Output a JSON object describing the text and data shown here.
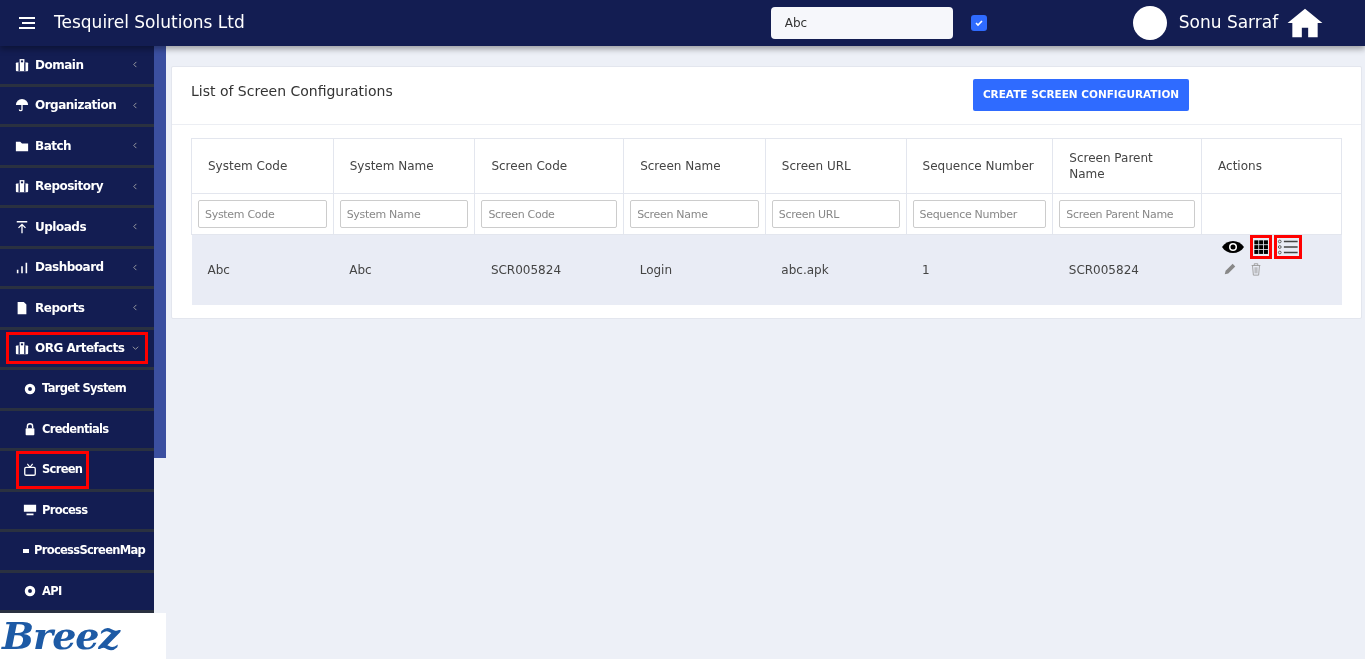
{
  "header": {
    "title": "Tesquirel Solutions Ltd",
    "search": {
      "value": "Abc"
    },
    "checkbox": {
      "checked": true
    },
    "user": "Sonu Sarraf"
  },
  "sidebar": {
    "items": [
      {
        "label": "Domain",
        "expanded": false,
        "highlighted": false
      },
      {
        "label": "Organization",
        "expanded": false,
        "highlighted": false
      },
      {
        "label": "Batch",
        "expanded": false,
        "highlighted": false
      },
      {
        "label": "Repository",
        "expanded": false,
        "highlighted": false
      },
      {
        "label": "Uploads",
        "expanded": false,
        "highlighted": false
      },
      {
        "label": "Dashboard",
        "expanded": false,
        "highlighted": false
      },
      {
        "label": "Reports",
        "expanded": false,
        "highlighted": false
      },
      {
        "label": "ORG Artefacts",
        "expanded": true,
        "highlighted": true,
        "children": [
          {
            "label": "Target System",
            "highlighted": false
          },
          {
            "label": "Credentials",
            "highlighted": false
          },
          {
            "label": "Screen",
            "highlighted": true
          },
          {
            "label": "Process",
            "highlighted": false
          },
          {
            "label": "ProcessScreenMap",
            "highlighted": false
          },
          {
            "label": "API",
            "highlighted": false
          }
        ]
      }
    ],
    "logo": "Breez"
  },
  "card": {
    "title": "List of Screen Configurations",
    "create_button": "CREATE SCREEN CONFIGURATION"
  },
  "table": {
    "columns": [
      "System Code",
      "System Name",
      "Screen Code",
      "Screen Name",
      "Screen URL",
      "Sequence Number",
      "Screen Parent Name",
      "Actions"
    ],
    "filters": [
      {
        "placeholder": "System Code"
      },
      {
        "placeholder": "System Name"
      },
      {
        "placeholder": "Screen Code"
      },
      {
        "placeholder": "Screen Name"
      },
      {
        "placeholder": "Screen URL"
      },
      {
        "placeholder": "Sequence Number"
      },
      {
        "placeholder": "Screen Parent Name"
      }
    ],
    "rows": [
      {
        "cells": [
          "Abc",
          "Abc",
          "SCR005824",
          "Login",
          "abc.apk",
          "1",
          "SCR005824"
        ],
        "actions": [
          {
            "kind": "view",
            "highlighted": false
          },
          {
            "kind": "grid",
            "highlighted": true
          },
          {
            "kind": "list",
            "highlighted": true
          },
          {
            "kind": "edit",
            "highlighted": false
          },
          {
            "kind": "delete",
            "highlighted": false
          }
        ]
      }
    ]
  }
}
